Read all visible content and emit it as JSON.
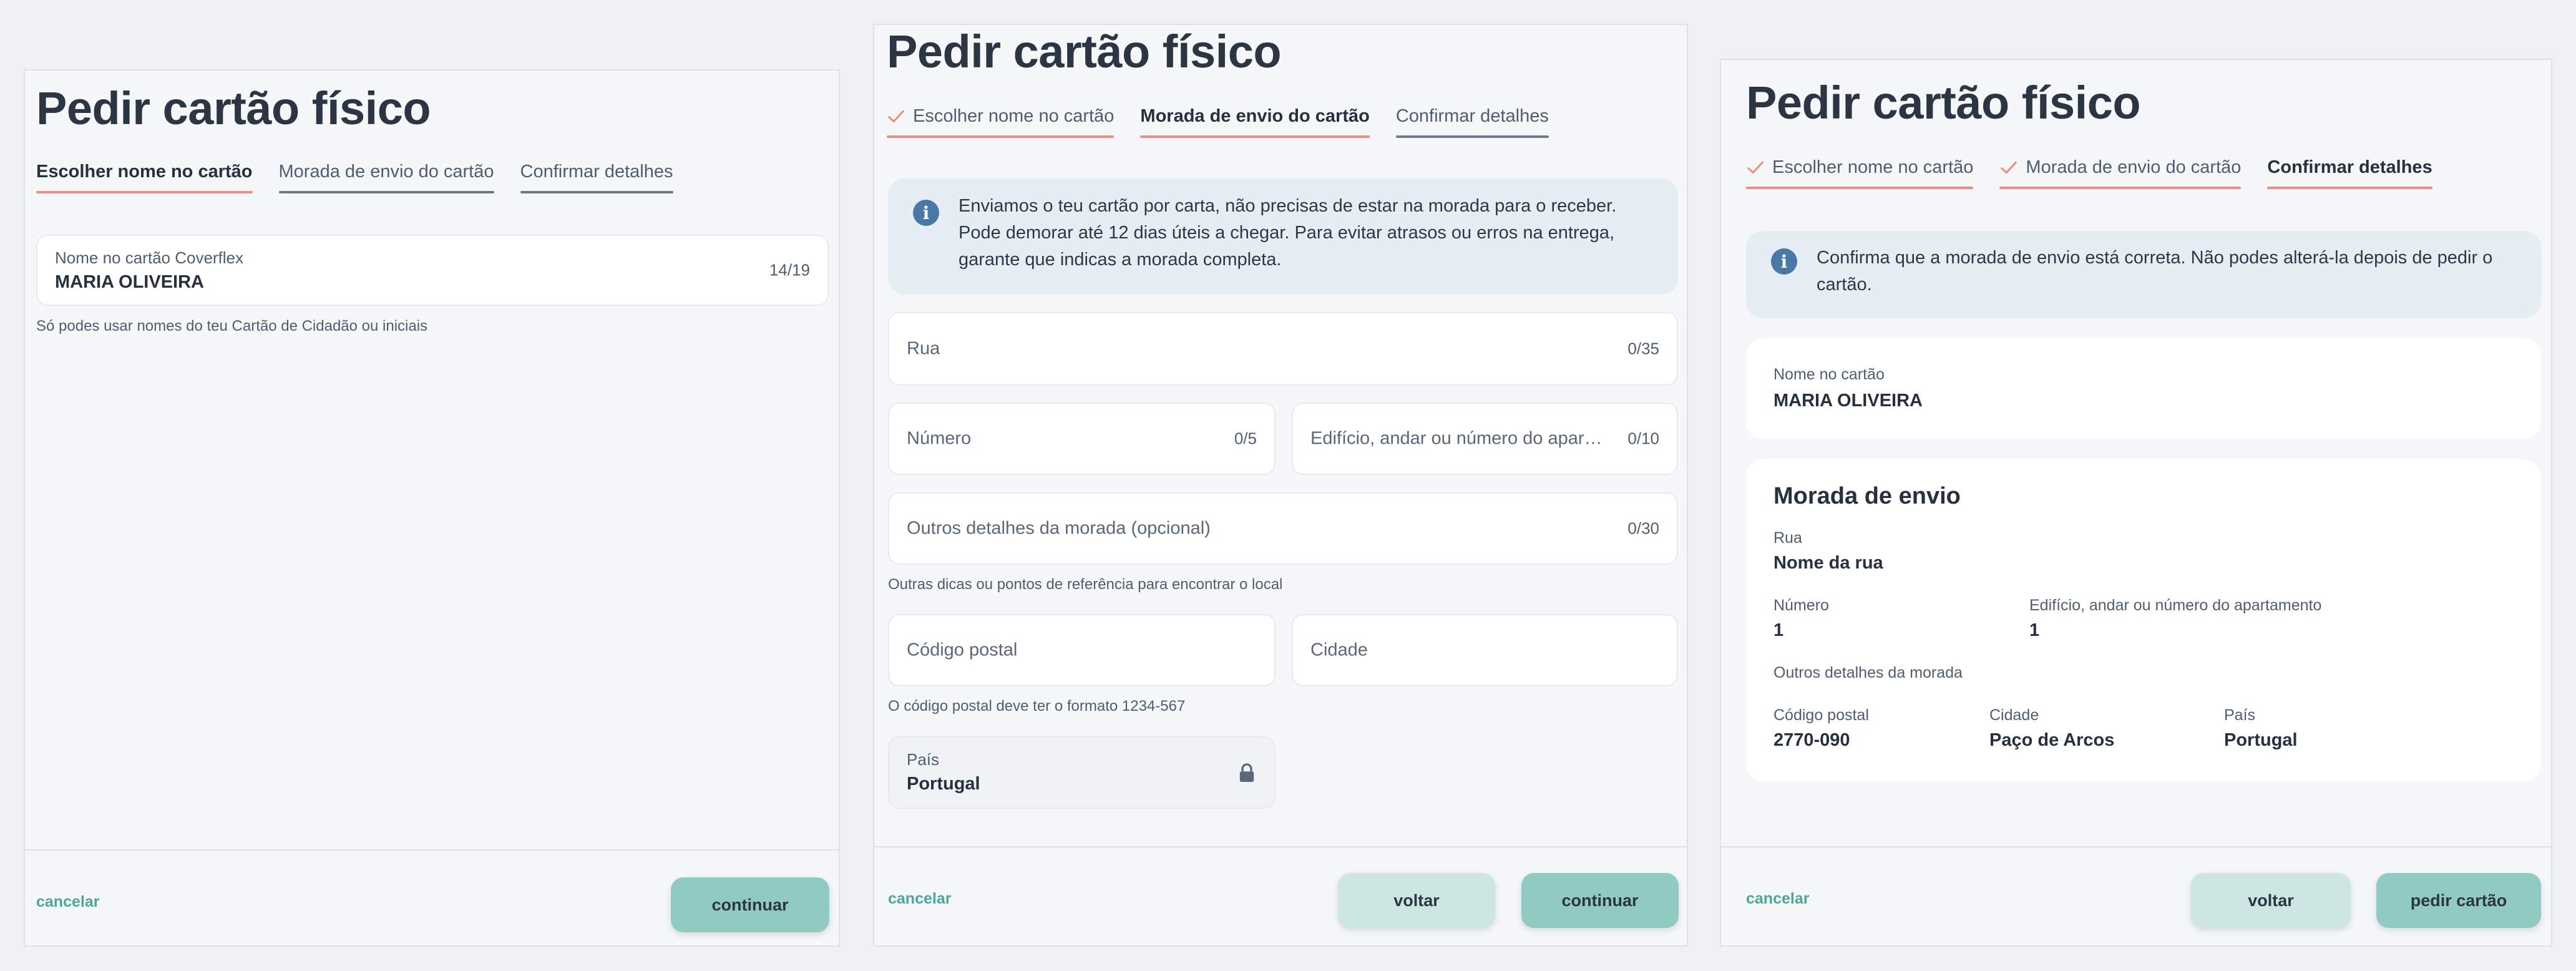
{
  "colors": {
    "accent": "#90cac3",
    "tab_done": "#ef8b82",
    "link": "#4aa89a",
    "info_bg": "#e4eef3"
  },
  "page_title": "Pedir cartão físico",
  "tabs": {
    "name": "Escolher nome no cartão",
    "address": "Morada de envio do cartão",
    "confirm": "Confirmar detalhes"
  },
  "step1": {
    "name_field": {
      "label": "Nome no cartão Coverflex",
      "value": "MARIA OLIVEIRA",
      "counter": "14/19"
    },
    "hint": "Só podes usar nomes do teu Cartão de Cidadão ou iniciais"
  },
  "step2": {
    "info": "Enviamos o teu cartão por carta, não precisas de estar na morada para o receber. Pode demorar até 12 dias úteis a chegar. Para evitar atrasos ou erros na entrega, garante que indicas a morada completa.",
    "street": {
      "placeholder": "Rua",
      "counter": "0/35"
    },
    "number": {
      "placeholder": "Número",
      "counter": "0/5"
    },
    "building": {
      "placeholder": "Edifício, andar ou número do apartamento",
      "counter": "0/10"
    },
    "other": {
      "placeholder": "Outros detalhes da morada (opcional)",
      "counter": "0/30"
    },
    "other_hint": "Outras dicas ou pontos de referência para encontrar o local",
    "postal": {
      "placeholder": "Código postal"
    },
    "city": {
      "placeholder": "Cidade"
    },
    "postal_hint": "O código postal deve ter o formato 1234-567",
    "country": {
      "label": "País",
      "value": "Portugal"
    }
  },
  "step3": {
    "info": "Confirma que a morada de envio está correta. Não podes alterá-la depois de pedir o cartão.",
    "name_card": {
      "label": "Nome no cartão",
      "value": "MARIA OLIVEIRA"
    },
    "address_card": {
      "heading": "Morada de envio",
      "street_label": "Rua",
      "street_value": "Nome da rua",
      "number_label": "Número",
      "number_value": "1",
      "building_label": "Edifício, andar ou número do apartamento",
      "building_value": "1",
      "other_label": "Outros detalhes da morada",
      "postal_label": "Código postal",
      "postal_value": "2770-090",
      "city_label": "Cidade",
      "city_value": "Paço de Arcos",
      "country_label": "País",
      "country_value": "Portugal"
    }
  },
  "footer": {
    "cancel": "cancelar",
    "continue": "continuar",
    "back": "voltar",
    "order": "pedir cartão"
  }
}
